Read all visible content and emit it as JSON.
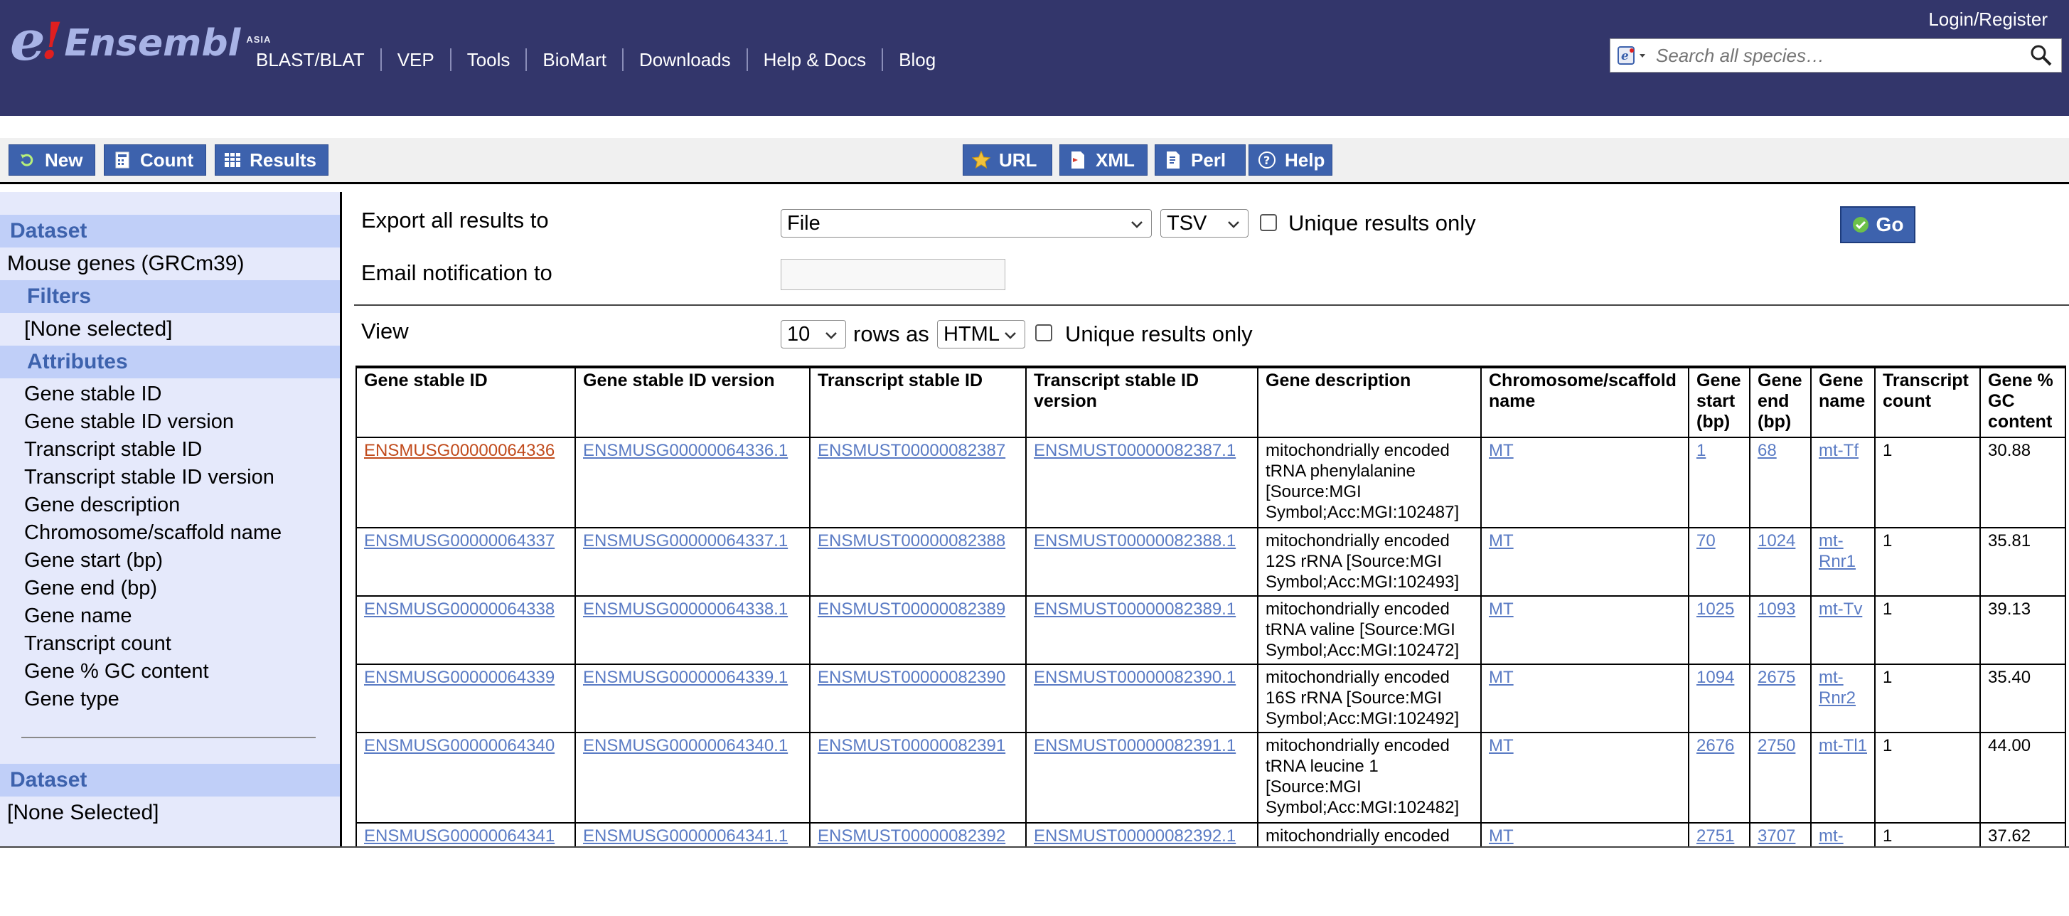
{
  "header": {
    "logo": {
      "e": "e",
      "bang": "!",
      "word": "Ensembl",
      "sup": "ASIA"
    },
    "nav": [
      "BLAST/BLAT",
      "VEP",
      "Tools",
      "BioMart",
      "Downloads",
      "Help & Docs",
      "Blog"
    ],
    "login": "Login/Register",
    "search_placeholder": "Search all species…"
  },
  "toolbar": {
    "left": [
      "New",
      "Count",
      "Results"
    ],
    "right": [
      "URL",
      "XML",
      "Perl",
      "Help"
    ]
  },
  "sidebar": {
    "dataset_head": "Dataset",
    "dataset_value": "Mouse genes (GRCm39)",
    "filters_head": "Filters",
    "filters_value": "[None selected]",
    "attributes_head": "Attributes",
    "attributes": [
      "Gene stable ID",
      "Gene stable ID version",
      "Transcript stable ID",
      "Transcript stable ID version",
      "Gene description",
      "Chromosome/scaffold name",
      "Gene start (bp)",
      "Gene end (bp)",
      "Gene name",
      "Transcript count",
      "Gene % GC content",
      "Gene type"
    ],
    "dataset2_head": "Dataset",
    "dataset2_value": "[None Selected]"
  },
  "export": {
    "label": "Export  all results to",
    "destination": "File",
    "format": "TSV",
    "unique_label": "Unique results only",
    "go": "Go",
    "email_label": "Email notification to"
  },
  "view": {
    "label": "View",
    "rows": "10",
    "rows_as": "rows as",
    "format": "HTML",
    "unique_label": "Unique results only"
  },
  "table": {
    "headers": [
      "Gene stable ID",
      "Gene stable ID version",
      "Transcript stable ID",
      "Transcript stable ID version",
      "Gene description",
      "Chromosome/scaffold name",
      "Gene start (bp)",
      "Gene end (bp)",
      "Gene name",
      "Transcript count",
      "Gene % GC content"
    ],
    "rows": [
      [
        "ENSMUSG00000064336",
        "ENSMUSG00000064336.1",
        "ENSMUST00000082387",
        "ENSMUST00000082387.1",
        "mitochondrially encoded tRNA phenylalanine [Source:MGI Symbol;Acc:MGI:102487]",
        "MT",
        "1",
        "68",
        "mt-Tf",
        "1",
        "30.88"
      ],
      [
        "ENSMUSG00000064337",
        "ENSMUSG00000064337.1",
        "ENSMUST00000082388",
        "ENSMUST00000082388.1",
        "mitochondrially encoded 12S rRNA [Source:MGI Symbol;Acc:MGI:102493]",
        "MT",
        "70",
        "1024",
        "mt-Rnr1",
        "1",
        "35.81"
      ],
      [
        "ENSMUSG00000064338",
        "ENSMUSG00000064338.1",
        "ENSMUST00000082389",
        "ENSMUST00000082389.1",
        "mitochondrially encoded tRNA valine [Source:MGI Symbol;Acc:MGI:102472]",
        "MT",
        "1025",
        "1093",
        "mt-Tv",
        "1",
        "39.13"
      ],
      [
        "ENSMUSG00000064339",
        "ENSMUSG00000064339.1",
        "ENSMUST00000082390",
        "ENSMUST00000082390.1",
        "mitochondrially encoded 16S rRNA [Source:MGI Symbol;Acc:MGI:102492]",
        "MT",
        "1094",
        "2675",
        "mt-Rnr2",
        "1",
        "35.40"
      ],
      [
        "ENSMUSG00000064340",
        "ENSMUSG00000064340.1",
        "ENSMUST00000082391",
        "ENSMUST00000082391.1",
        "mitochondrially encoded tRNA leucine 1 [Source:MGI Symbol;Acc:MGI:102482]",
        "MT",
        "2676",
        "2750",
        "mt-Tl1",
        "1",
        "44.00"
      ],
      [
        "ENSMUSG00000064341",
        "ENSMUSG00000064341.1",
        "ENSMUST00000082392",
        "ENSMUST00000082392.1",
        "mitochondrially encoded",
        "MT",
        "2751",
        "3707",
        "mt-",
        "1",
        "37.62"
      ]
    ]
  }
}
